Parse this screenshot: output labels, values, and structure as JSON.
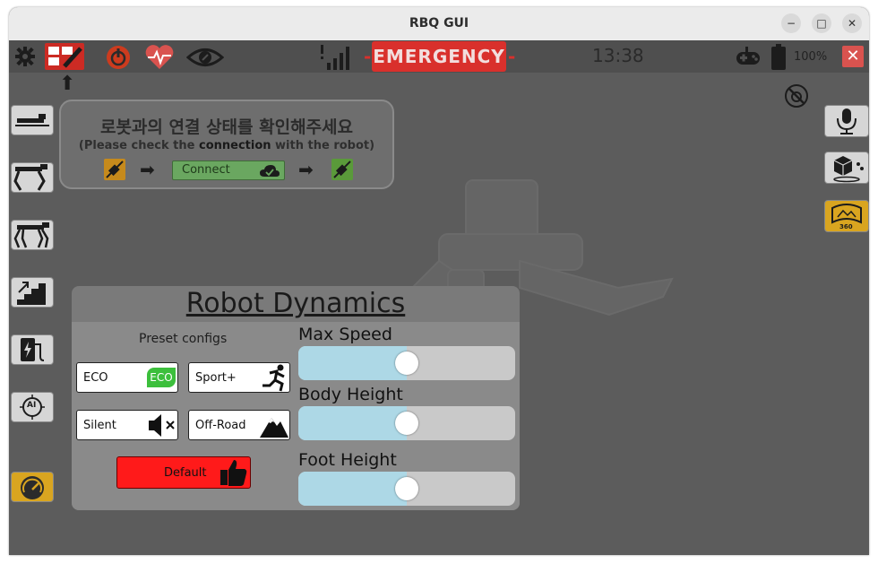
{
  "window": {
    "title": "RBQ GUI",
    "minimize_icon": "−",
    "maximize_icon": "□",
    "close_icon": "✕"
  },
  "toolbar": {
    "emergency_label": "EMERGENCY",
    "emergency_left_dash": "-",
    "emergency_right_dash": "-",
    "time": "13:38",
    "battery": "100%",
    "close_label": "✕",
    "colors": {
      "emergency": "#d9302c",
      "close": "#d9534f",
      "power": "#cc3b1e",
      "heart": "#d9534f"
    }
  },
  "connection": {
    "title_ko": "로봇과의 연결 상태를 확인해주세요",
    "subtitle_pre": "(Please check the ",
    "subtitle_bold": "connection",
    "subtitle_post": " with the robot)",
    "connect_label": "Connect",
    "arrow": "➡"
  },
  "dynamics": {
    "title": "Robot Dynamics",
    "preset_label": "Preset configs",
    "presets": {
      "eco": "ECO",
      "eco_badge": "ECO",
      "sport": "Sport+",
      "silent": "Silent",
      "offroad": "Off-Road"
    },
    "default_label": "Default",
    "sliders": {
      "max_speed": {
        "label": "Max Speed",
        "level": 0.5
      },
      "body_height": {
        "label": "Body Height",
        "level": 0.5
      },
      "foot_height": {
        "label": "Foot Height",
        "level": 0.5
      }
    }
  },
  "side_right": {
    "badge_360": "360"
  },
  "side_left": {
    "ai_label": "AI"
  }
}
